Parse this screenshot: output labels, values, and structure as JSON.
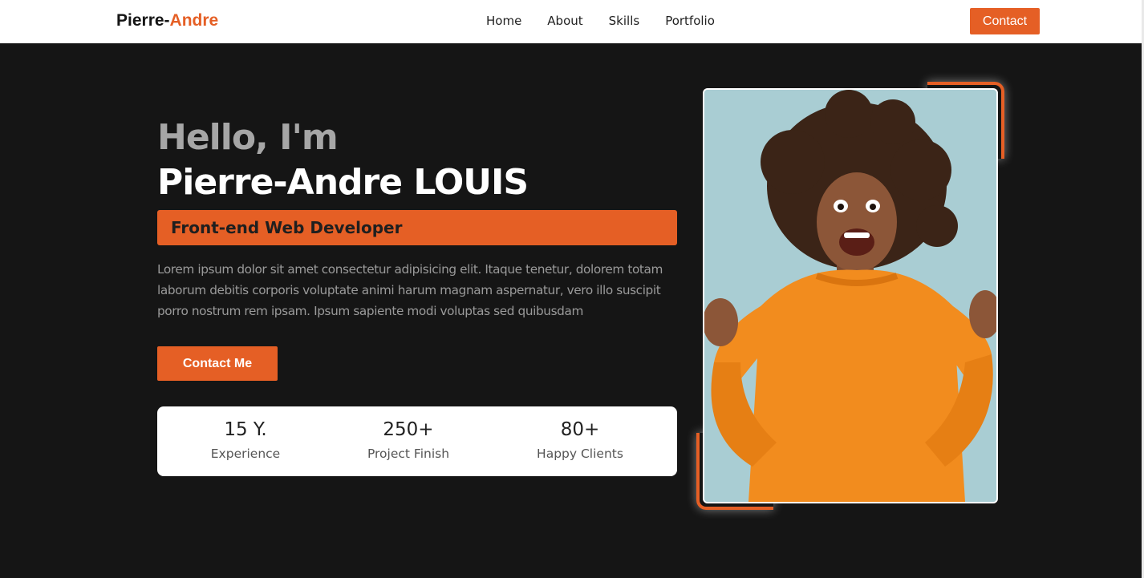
{
  "header": {
    "logo_first": "Pierre-",
    "logo_accent": "Andre",
    "nav": [
      "Home",
      "About",
      "Skills",
      "Portfolio"
    ],
    "contact_label": "Contact"
  },
  "hero": {
    "greeting": "Hello, I'm",
    "name": "Pierre-Andre LOUIS",
    "role": "Front-end Web Developer",
    "bio": "Lorem ipsum dolor sit amet consectetur adipisicing elit. Itaque tenetur, dolorem totam laborum debitis corporis voluptate animi harum magnam aspernatur, vero illo suscipit porro nostrum rem ipsam. Ipsum sapiente modi voluptas sed quibusdam",
    "cta_label": "Contact Me"
  },
  "stats": [
    {
      "value": "15 Y.",
      "label": "Experience"
    },
    {
      "value": "250+",
      "label": "Project Finish"
    },
    {
      "value": "80+",
      "label": "Happy Clients"
    }
  ],
  "colors": {
    "accent": "#e55f25",
    "background": "#151515",
    "photo_background": "#a9cdd3",
    "sweater": "#f28c1e"
  },
  "photo": {
    "icon": "portrait-photo-icon"
  }
}
